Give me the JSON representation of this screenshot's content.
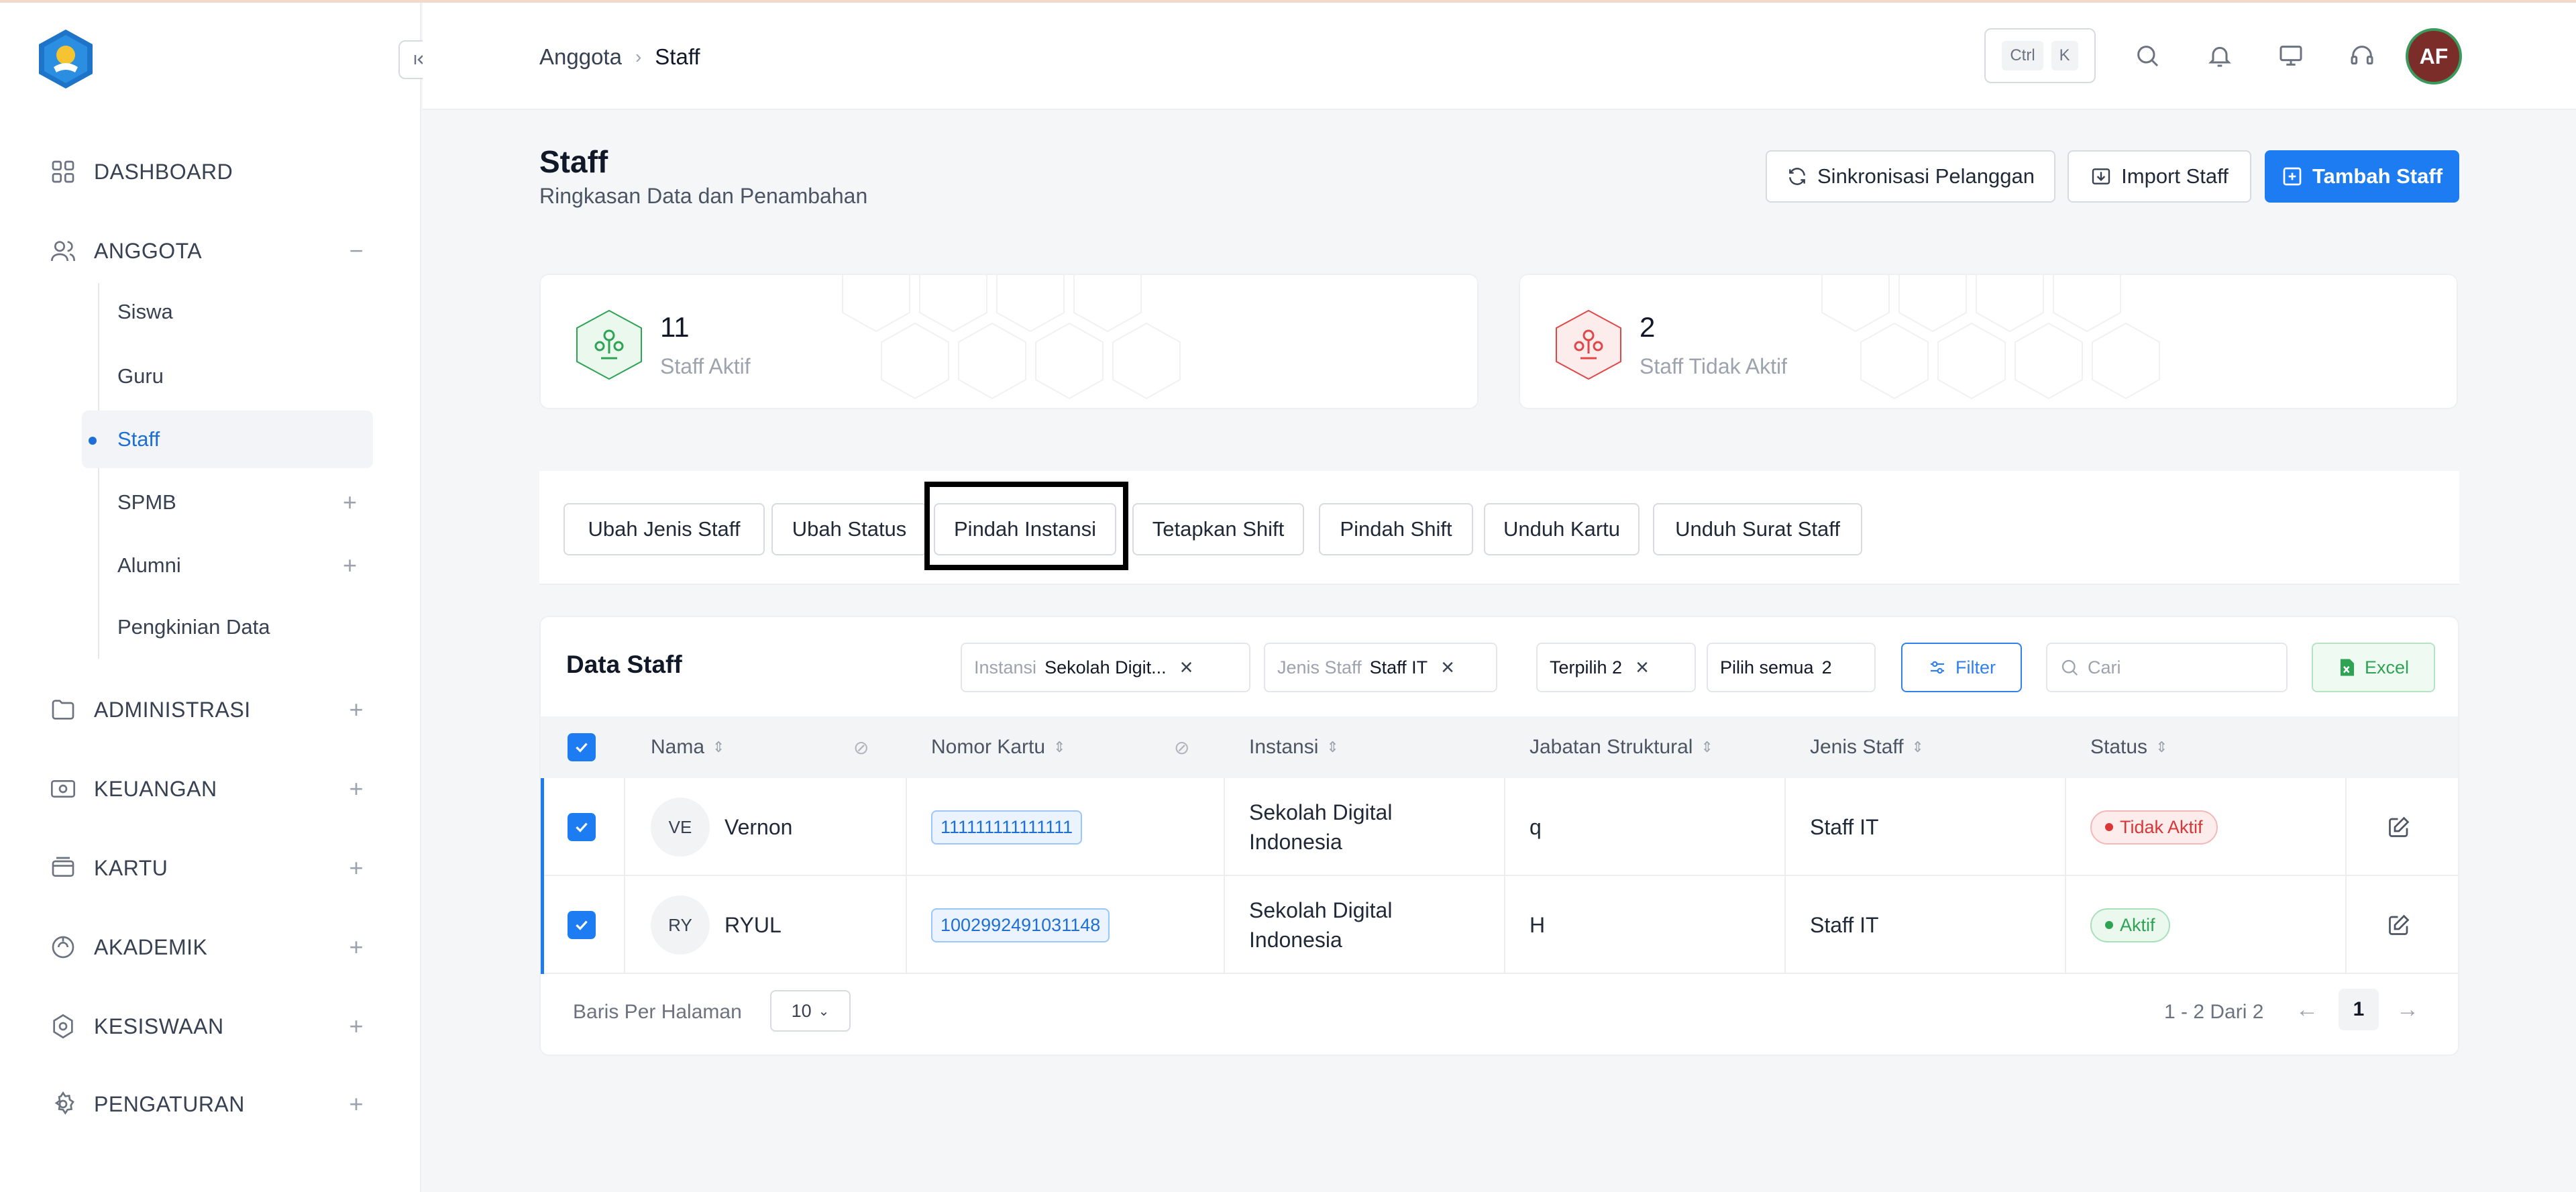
{
  "header": {
    "breadcrumb": [
      "Anggota",
      "Staff"
    ],
    "shortcut_keys": [
      "Ctrl",
      "K"
    ],
    "avatar_initials": "AF"
  },
  "sidebar": {
    "items": [
      {
        "label": "DASHBOARD",
        "icon": "grid-icon"
      },
      {
        "label": "ANGGOTA",
        "icon": "users-icon",
        "expanded": true
      },
      {
        "label": "ADMINISTRASI",
        "icon": "folder-icon"
      },
      {
        "label": "KEUANGAN",
        "icon": "money-icon"
      },
      {
        "label": "KARTU",
        "icon": "card-icon"
      },
      {
        "label": "AKADEMIK",
        "icon": "academic-icon"
      },
      {
        "label": "KESISWAAN",
        "icon": "student-icon"
      },
      {
        "label": "PENGATURAN",
        "icon": "gear-icon"
      }
    ],
    "subitems": [
      "Siswa",
      "Guru",
      "Staff",
      "SPMB",
      "Alumni",
      "Pengkinian Data"
    ],
    "active_subitem": "Staff"
  },
  "page": {
    "title": "Staff",
    "subtitle": "Ringkasan Data dan Penambahan",
    "buttons": {
      "sync": "Sinkronisasi Pelanggan",
      "import": "Import Staff",
      "add": "Tambah Staff"
    }
  },
  "stats": [
    {
      "value": "11",
      "label": "Staff Aktif",
      "color": "#2ea354"
    },
    {
      "value": "2",
      "label": "Staff Tidak Aktif",
      "color": "#e04848"
    }
  ],
  "actions": [
    "Ubah Jenis Staff",
    "Ubah Status",
    "Pindah Instansi",
    "Tetapkan Shift",
    "Pindah Shift",
    "Unduh Kartu",
    "Unduh Surat Staff"
  ],
  "table": {
    "title": "Data Staff",
    "filters": [
      {
        "key": "Instansi",
        "value": "Sekolah Digit..."
      },
      {
        "key": "Jenis Staff",
        "value": "Staff IT"
      }
    ],
    "selected_label": "Terpilih 2",
    "select_all_label": "Pilih semua",
    "select_all_count": "2",
    "filter_button": "Filter",
    "search_placeholder": "Cari",
    "excel_button": "Excel",
    "columns": [
      "Nama",
      "Nomor Kartu",
      "Instansi",
      "Jabatan Struktural",
      "Jenis Staff",
      "Status"
    ],
    "rows": [
      {
        "initials": "VE",
        "name": "Vernon",
        "card": "111111111111111",
        "instansi_1": "Sekolah Digital",
        "instansi_2": "Indonesia",
        "jabatan": "q",
        "jenis": "Staff IT",
        "status": "Tidak Aktif"
      },
      {
        "initials": "RY",
        "name": "RYUL",
        "card": "1002992491031148",
        "instansi_1": "Sekolah Digital",
        "instansi_2": "Indonesia",
        "jabatan": "H",
        "jenis": "Staff IT",
        "status": "Aktif"
      }
    ],
    "pager": {
      "rows_label": "Baris Per Halaman",
      "rows_value": "10",
      "info": "1 - 2 Dari 2",
      "page": "1"
    }
  },
  "colors": {
    "primary": "#1e7cf2",
    "active": "#2ea354",
    "inactive": "#d93636"
  }
}
